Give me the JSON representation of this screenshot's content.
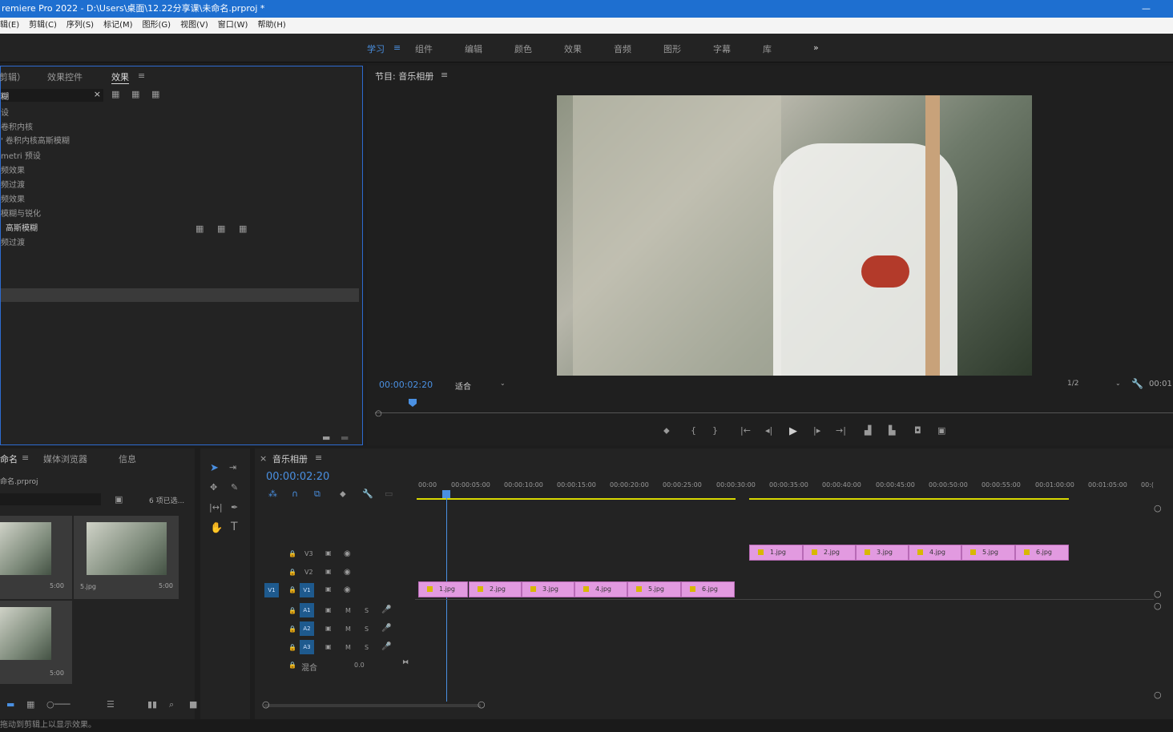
{
  "title": "remiere Pro 2022 - D:\\Users\\桌面\\12.22分享课\\未命名.prproj *",
  "menu": [
    "辑(E)",
    "剪辑(C)",
    "序列(S)",
    "标记(M)",
    "图形(G)",
    "视图(V)",
    "窗口(W)",
    "帮助(H)"
  ],
  "workspaces": [
    "学习",
    "组件",
    "编辑",
    "颜色",
    "效果",
    "音频",
    "图形",
    "字幕",
    "库",
    "»"
  ],
  "effects_panel": {
    "tabs": [
      "剪辑）",
      "效果控件",
      "效果"
    ],
    "search_value": "糊",
    "items": [
      "设",
      "卷积内核",
      "' 卷积内核高斯模糊",
      "metri 预设",
      "频效果",
      "频过渡",
      "频效果",
      "模糊与锐化",
      "高斯模糊",
      "频过渡"
    ]
  },
  "program_monitor": {
    "title": "节目: 音乐相册",
    "timecode": "00:00:02:20",
    "fit": "适合",
    "resolution": "1/2",
    "end_timecode": "00:01"
  },
  "project_panel": {
    "tabs": [
      "命名",
      "媒体浏览器",
      "信息"
    ],
    "file": "命名.prproj",
    "selected": "6 项已选...",
    "thumbs": [
      {
        "label": "",
        "duration": "5:00"
      },
      {
        "label": "5.jpg",
        "duration": "5:00"
      },
      {
        "label": "",
        "duration": "5:00"
      }
    ]
  },
  "timeline": {
    "title": "音乐相册",
    "timecode": "00:00:02:20",
    "ruler": [
      "00:00",
      "00:00:05:00",
      "00:00:10:00",
      "00:00:15:00",
      "00:00:20:00",
      "00:00:25:00",
      "00:00:30:00",
      "00:00:35:00",
      "00:00:40:00",
      "00:00:45:00",
      "00:00:50:00",
      "00:00:55:00",
      "00:01:00:00",
      "00:01:05:00",
      "00:("
    ],
    "tracks": [
      "V3",
      "V2",
      "V1",
      "A1",
      "A2",
      "A3"
    ],
    "mix_label": "混合",
    "mix_value": "0.0",
    "v1_clips": [
      "1.jpg",
      "2.jpg",
      "3.jpg",
      "4.jpg",
      "5.jpg",
      "6.jpg"
    ],
    "v3_clips": [
      "1.jpg",
      "2.jpg",
      "3.jpg",
      "4.jpg",
      "5.jpg",
      "6.jpg"
    ]
  },
  "status": "拖动到剪辑上以显示效果。"
}
